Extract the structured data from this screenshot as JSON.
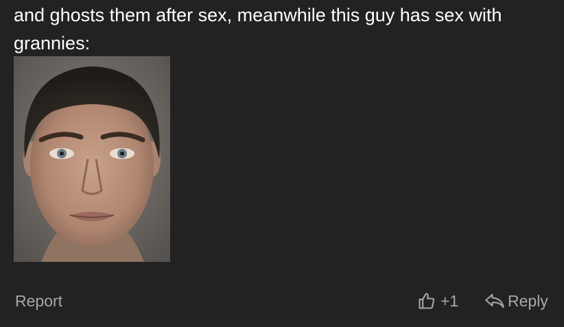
{
  "comment": {
    "text": "and ghosts them after sex, meanwhile this guy has sex with grannies:",
    "image": {
      "alt": "face-photo",
      "colors": {
        "background": "#6a6560",
        "skin": "#b9917a",
        "hair": "#2e2a24"
      }
    }
  },
  "actions": {
    "report_label": "Report",
    "upvote_icon": "thumbs-up-icon",
    "upvote_count": "+1",
    "reply_icon": "reply-arrow-icon",
    "reply_label": "Reply"
  },
  "theme": {
    "background": "#222222",
    "text": "#ffffff",
    "muted": "#a8a8a8"
  }
}
